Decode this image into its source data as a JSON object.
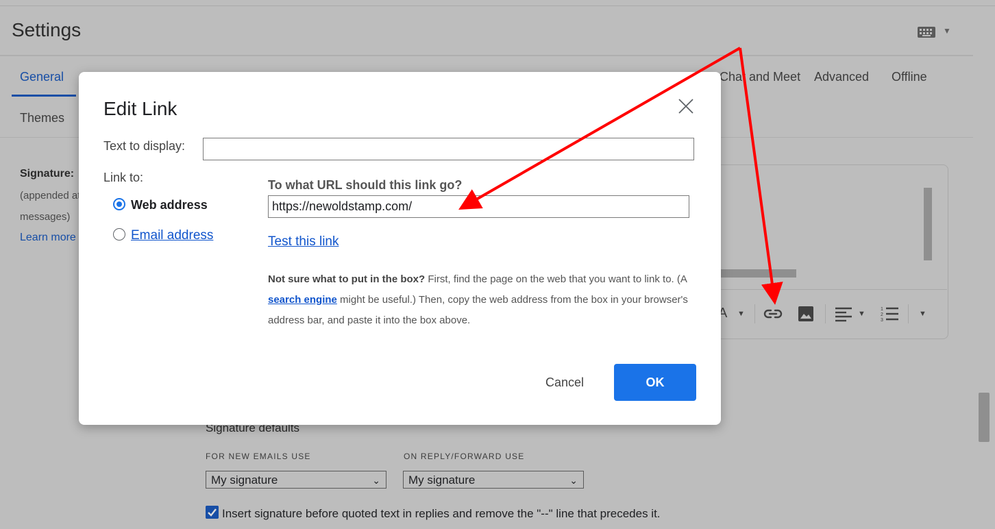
{
  "page": {
    "title": "Settings",
    "tabs": {
      "general": "General",
      "chat": "Chat and Meet",
      "advanced": "Advanced",
      "offline": "Offline",
      "themes": "Themes"
    },
    "signature": {
      "label": "Signature:",
      "note_line1": "(appended at the end of all outgoing",
      "note_line2": "messages)",
      "learn_more": "Learn more"
    },
    "signature_defaults": {
      "heading": "Signature defaults",
      "new_emails_caption": "FOR NEW EMAILS USE",
      "reply_caption": "ON REPLY/FORWARD USE",
      "new_emails_value": "My signature",
      "reply_value": "My signature",
      "insert_checkbox_label": "Insert signature before quoted text in replies and remove the \"--\" line that precedes it.",
      "insert_checked": true
    },
    "toolbar_icons": [
      "text-color-icon",
      "link-icon",
      "image-icon",
      "align-icon",
      "numbered-list-icon",
      "more-options-icon"
    ]
  },
  "dialog": {
    "title": "Edit Link",
    "text_to_display_label": "Text to display:",
    "text_to_display_value": "",
    "link_to_label": "Link to:",
    "option_web": "Web address",
    "option_email": "Email address",
    "selected_option": "Web address",
    "url_question": "To what URL should this link go?",
    "url_value": "https://newoldstamp.com/",
    "test_link": "Test this link",
    "help_bold": "Not sure what to put in the box?",
    "help_part1": " First, find the page on the web that you want to link to. (A ",
    "help_link": "search engine",
    "help_part2": " might be useful.) Then, copy the web address from the box in your browser's address bar, and paste it into the box above.",
    "cancel_label": "Cancel",
    "ok_label": "OK"
  },
  "colors": {
    "primary": "#1a73e8",
    "link": "#1155cc",
    "annotation_arrow": "#ff0000",
    "overlay_bg": "#bdbdbd"
  }
}
